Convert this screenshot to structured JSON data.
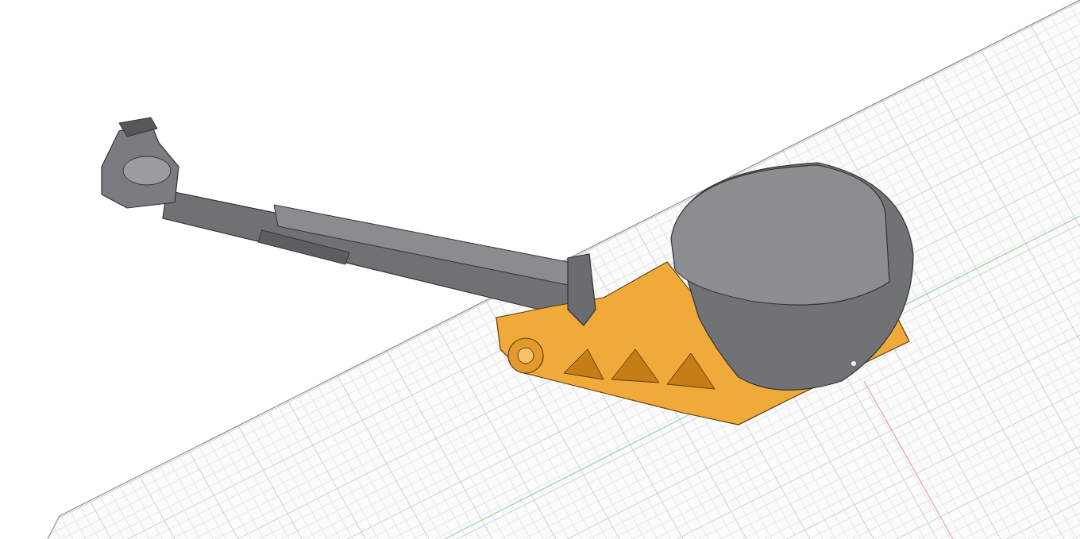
{
  "viewport": {
    "kind": "cad-3d-view",
    "grid": true
  }
}
